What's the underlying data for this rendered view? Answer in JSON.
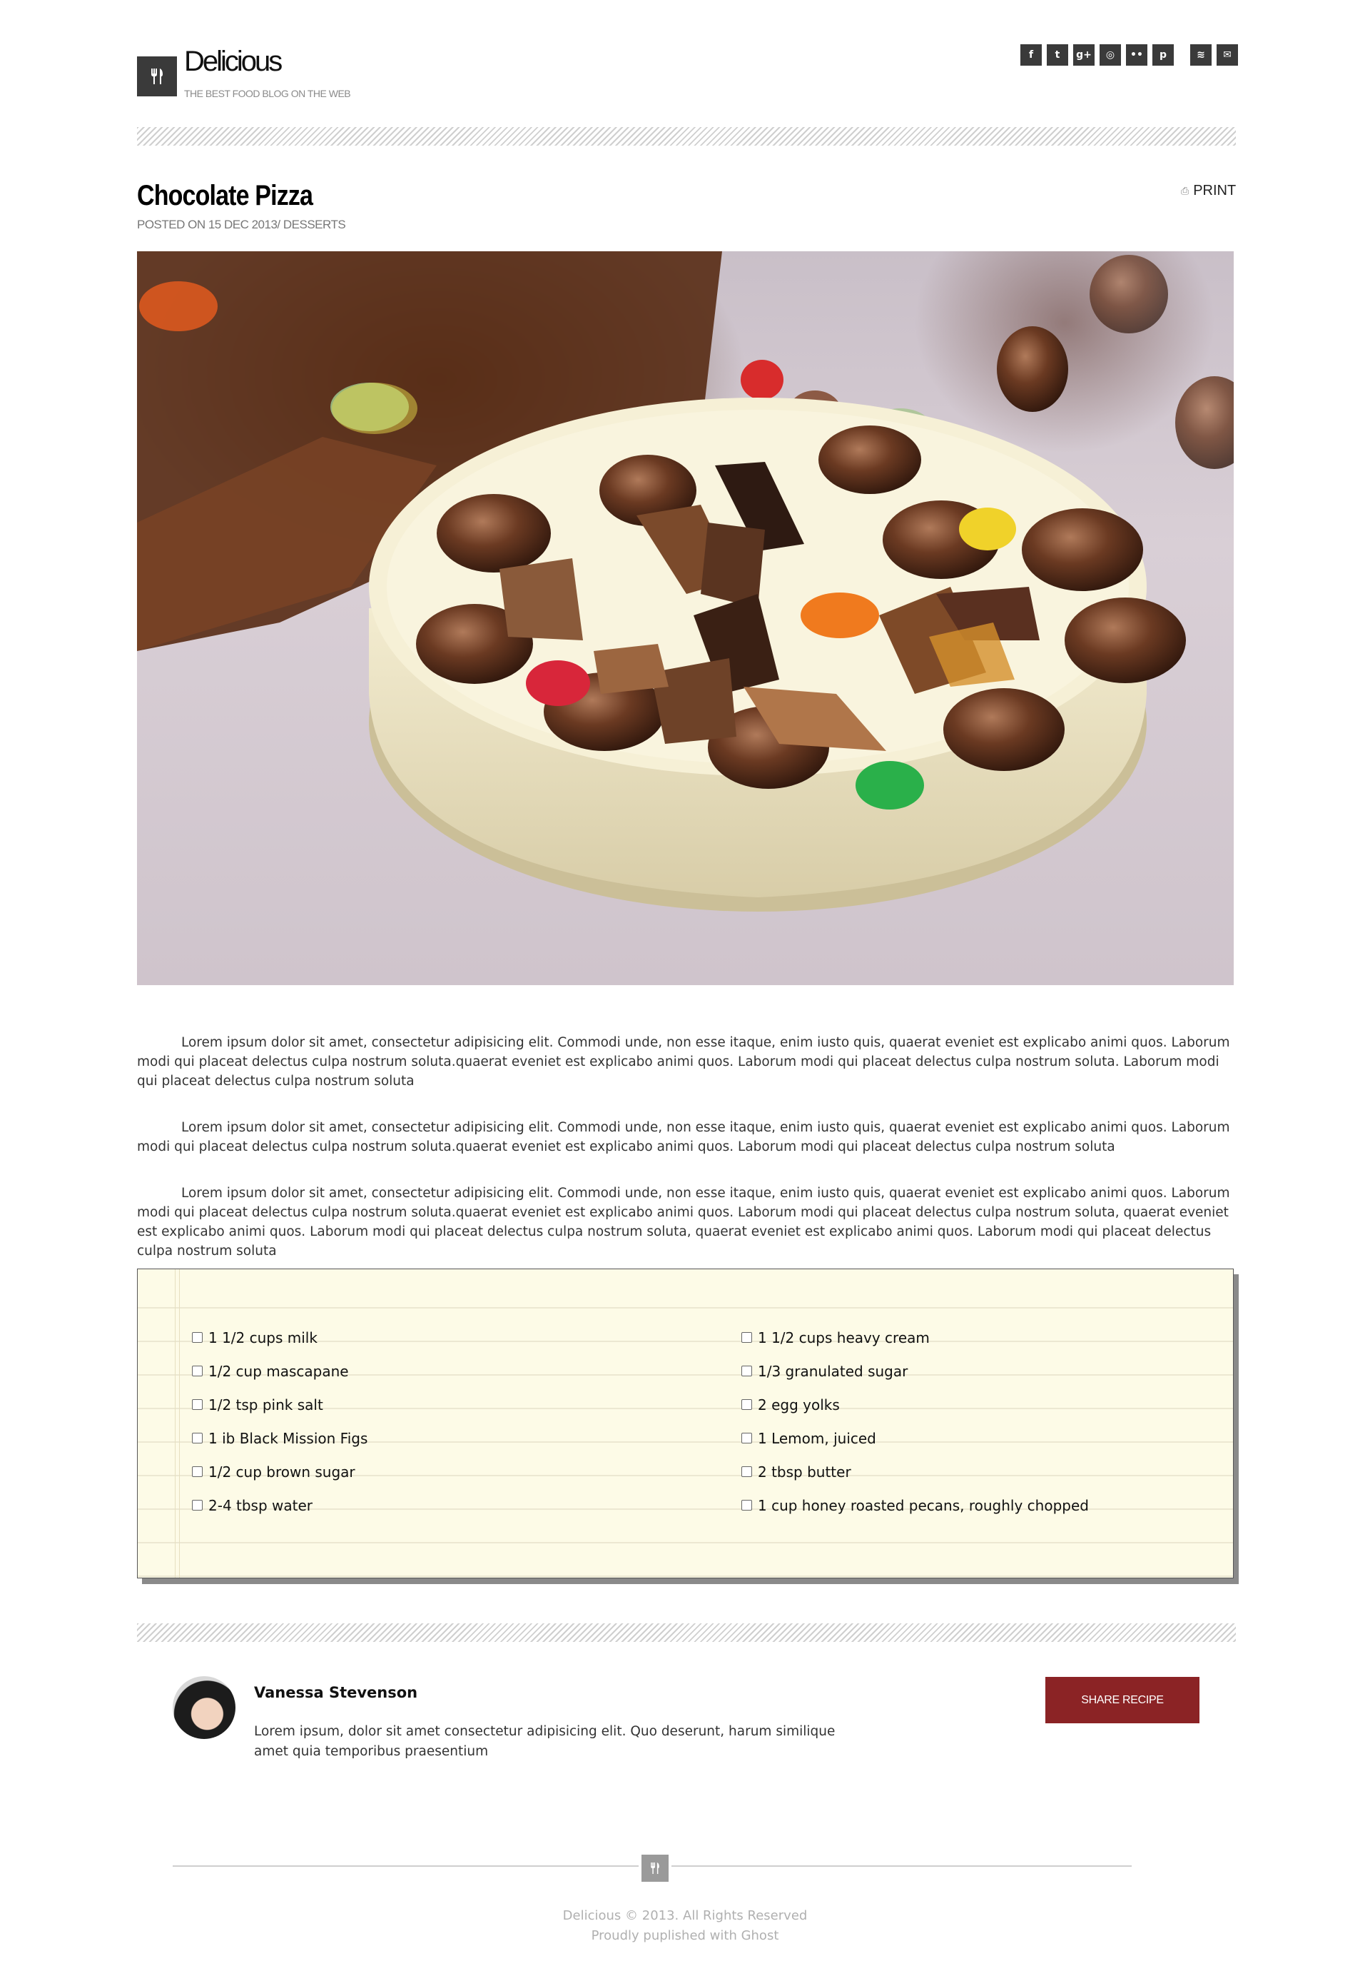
{
  "header": {
    "site_title": "Delicious",
    "tagline": "THE BEST FOOD BLOG ON THE WEB",
    "logo_icon": "utensils-icon",
    "social_icons": [
      {
        "name": "facebook-icon",
        "glyph": "f"
      },
      {
        "name": "twitter-icon",
        "glyph": "t"
      },
      {
        "name": "google-plus-icon",
        "glyph": "g+"
      },
      {
        "name": "instagram-icon",
        "glyph": "◎"
      },
      {
        "name": "flickr-icon",
        "glyph": "••"
      },
      {
        "name": "pinterest-icon",
        "glyph": "p"
      },
      {
        "name": "rss-icon",
        "glyph": "≋"
      },
      {
        "name": "mail-icon",
        "glyph": "✉"
      }
    ]
  },
  "post": {
    "title": "Chocolate Pizza",
    "meta": "POSTED ON 15 DEC 2013/ DESSERTS",
    "print_label": "PRINT",
    "print_icon": "printer-icon",
    "hero_image_alt": "chocolate-pizza-photo",
    "paragraphs": [
      "Lorem ipsum dolor sit amet, consectetur adipisicing elit. Commodi unde, non esse itaque, enim iusto quis, quaerat eveniet est explicabo animi quos. Laborum modi qui placeat delectus culpa nostrum soluta.quaerat eveniet est explicabo animi quos. Laborum modi qui placeat delectus culpa nostrum soluta. Laborum modi qui placeat delectus culpa nostrum soluta",
      "Lorem ipsum dolor sit amet, consectetur adipisicing elit. Commodi unde, non esse itaque, enim iusto quis, quaerat eveniet est explicabo animi quos. Laborum modi qui placeat delectus culpa nostrum soluta.quaerat eveniet est explicabo animi quos. Laborum modi qui placeat delectus culpa nostrum soluta",
      "Lorem ipsum dolor sit amet, consectetur adipisicing elit. Commodi unde, non esse itaque, enim iusto quis, quaerat eveniet est explicabo animi quos. Laborum modi qui placeat delectus culpa nostrum soluta.quaerat eveniet est explicabo animi quos. Laborum modi qui placeat delectus culpa nostrum soluta, quaerat eveniet est explicabo animi quos. Laborum modi qui placeat delectus culpa nostrum soluta, quaerat eveniet est explicabo animi quos. Laborum modi qui placeat delectus culpa nostrum soluta"
    ]
  },
  "ingredients": {
    "left": [
      "1 1/2 cups milk",
      "1/2 cup mascapane",
      "1/2 tsp pink salt",
      "1 ib Black Mission Figs",
      "1/2 cup brown sugar",
      "2-4 tbsp water"
    ],
    "right": [
      "1 1/2 cups heavy cream",
      "1/3 granulated sugar",
      "2 egg yolks",
      "1 Lemom, juiced",
      "2 tbsp butter",
      "1 cup honey roasted pecans, roughly chopped"
    ]
  },
  "author": {
    "name": "Vanessa Stevenson",
    "bio": "Lorem ipsum, dolor sit amet consectetur adipisicing elit. Quo deserunt, harum similique amet quia temporibus praesentium",
    "share_label": "SHARE RECIPE"
  },
  "footer": {
    "line1": "Delicious © 2013. All Rights Reserved",
    "line2": "Proudly puplished with Ghost"
  },
  "colors": {
    "accent": "#8b2325",
    "dark_icon": "#3a3a3a",
    "notepad_bg": "#fdfbe7"
  }
}
